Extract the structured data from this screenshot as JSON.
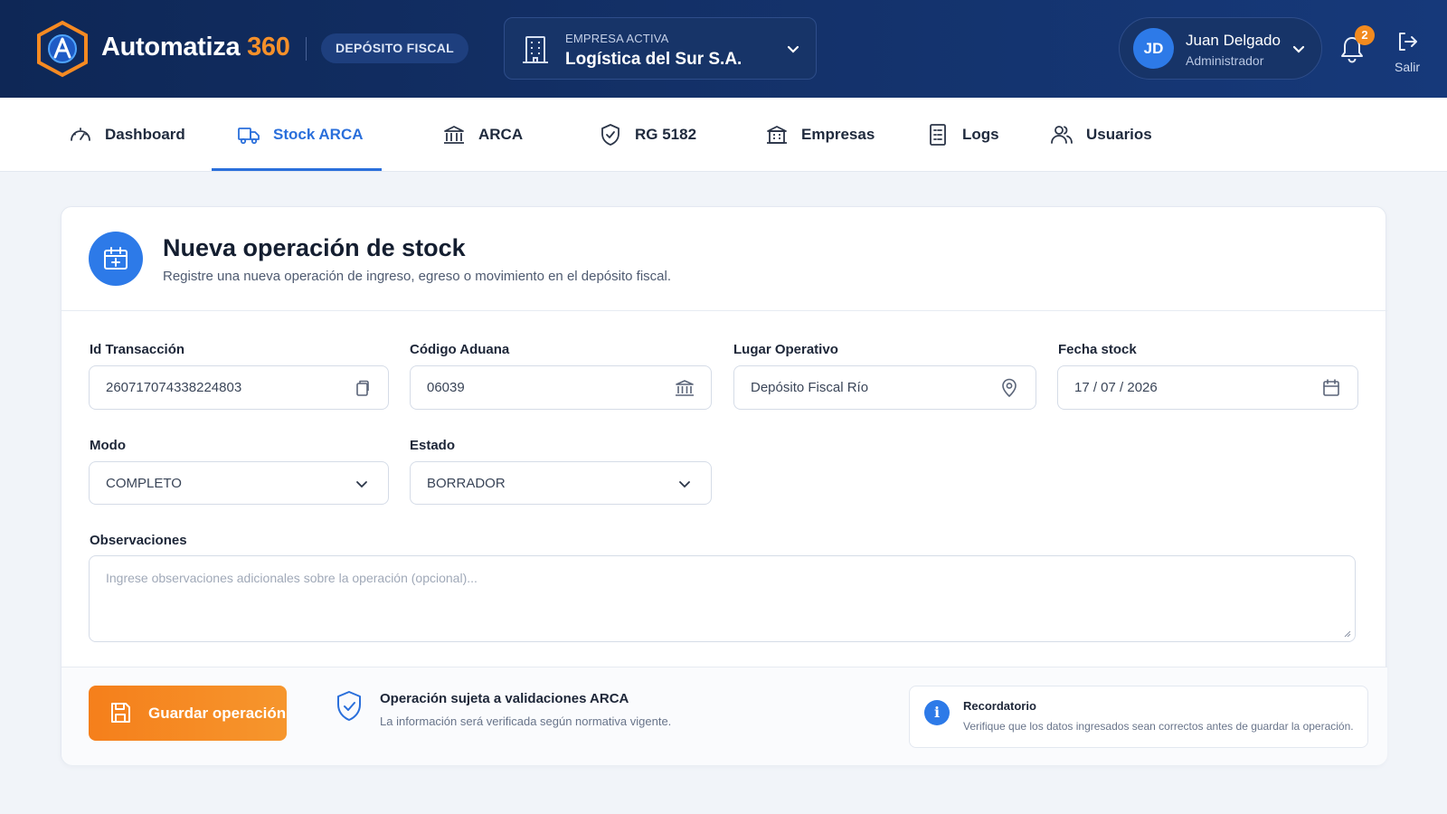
{
  "app": {
    "brand_name": "Automatiza",
    "brand_number": "360",
    "module_pill": "DEPÓSITO FISCAL"
  },
  "company": {
    "label": "EMPRESA ACTIVA",
    "value": "Logística del Sur S.A."
  },
  "user": {
    "initials": "JD",
    "name": "Juan Delgado",
    "role": "Administrador"
  },
  "notifications": {
    "count": "2"
  },
  "exit": {
    "label": "Salir"
  },
  "nav": {
    "tabs": [
      {
        "label": "Dashboard",
        "icon": "gauge-icon"
      },
      {
        "label": "Stock ARCA",
        "icon": "truck-icon",
        "active": true
      },
      {
        "label": "ARCA",
        "icon": "bank-icon"
      },
      {
        "label": "RG 5182",
        "icon": "shield-check-icon"
      },
      {
        "label": "Empresas",
        "icon": "building-icon"
      },
      {
        "label": "Logs",
        "icon": "document-list-icon"
      },
      {
        "label": "Usuarios",
        "icon": "users-icon"
      }
    ]
  },
  "form": {
    "title": "Nueva operación de stock",
    "subtitle": "Registre una nueva operación de ingreso, egreso o movimiento en el depósito fiscal.",
    "fields": {
      "id_transaccion": {
        "label": "Id Transacción",
        "value": "260717074338224803"
      },
      "codigo_aduana": {
        "label": "Código Aduana",
        "value": "06039"
      },
      "lugar_operativo": {
        "label": "Lugar Operativo",
        "value": "Depósito Fiscal Río"
      },
      "fecha_stock": {
        "label": "Fecha stock",
        "value": "17 / 07 / 2026"
      },
      "modo": {
        "label": "Modo",
        "value": "COMPLETO"
      },
      "estado": {
        "label": "Estado",
        "value": "BORRADOR"
      },
      "observaciones": {
        "label": "Observaciones",
        "placeholder": "Ingrese observaciones adicionales sobre la operación (opcional)..."
      }
    },
    "save_label": "Guardar operación",
    "validation": {
      "title": "Operación sujeta a validaciones ARCA",
      "subtitle": "La información será verificada según normativa vigente."
    },
    "reminder": {
      "title": "Recordatorio",
      "text": "Verifique que los datos ingresados sean correctos antes de guardar la operación."
    }
  },
  "colors": {
    "header": "#0e2756",
    "accent": "#2a6fdb",
    "brand_orange": "#f6902a",
    "save_button": "#f57f1b"
  }
}
